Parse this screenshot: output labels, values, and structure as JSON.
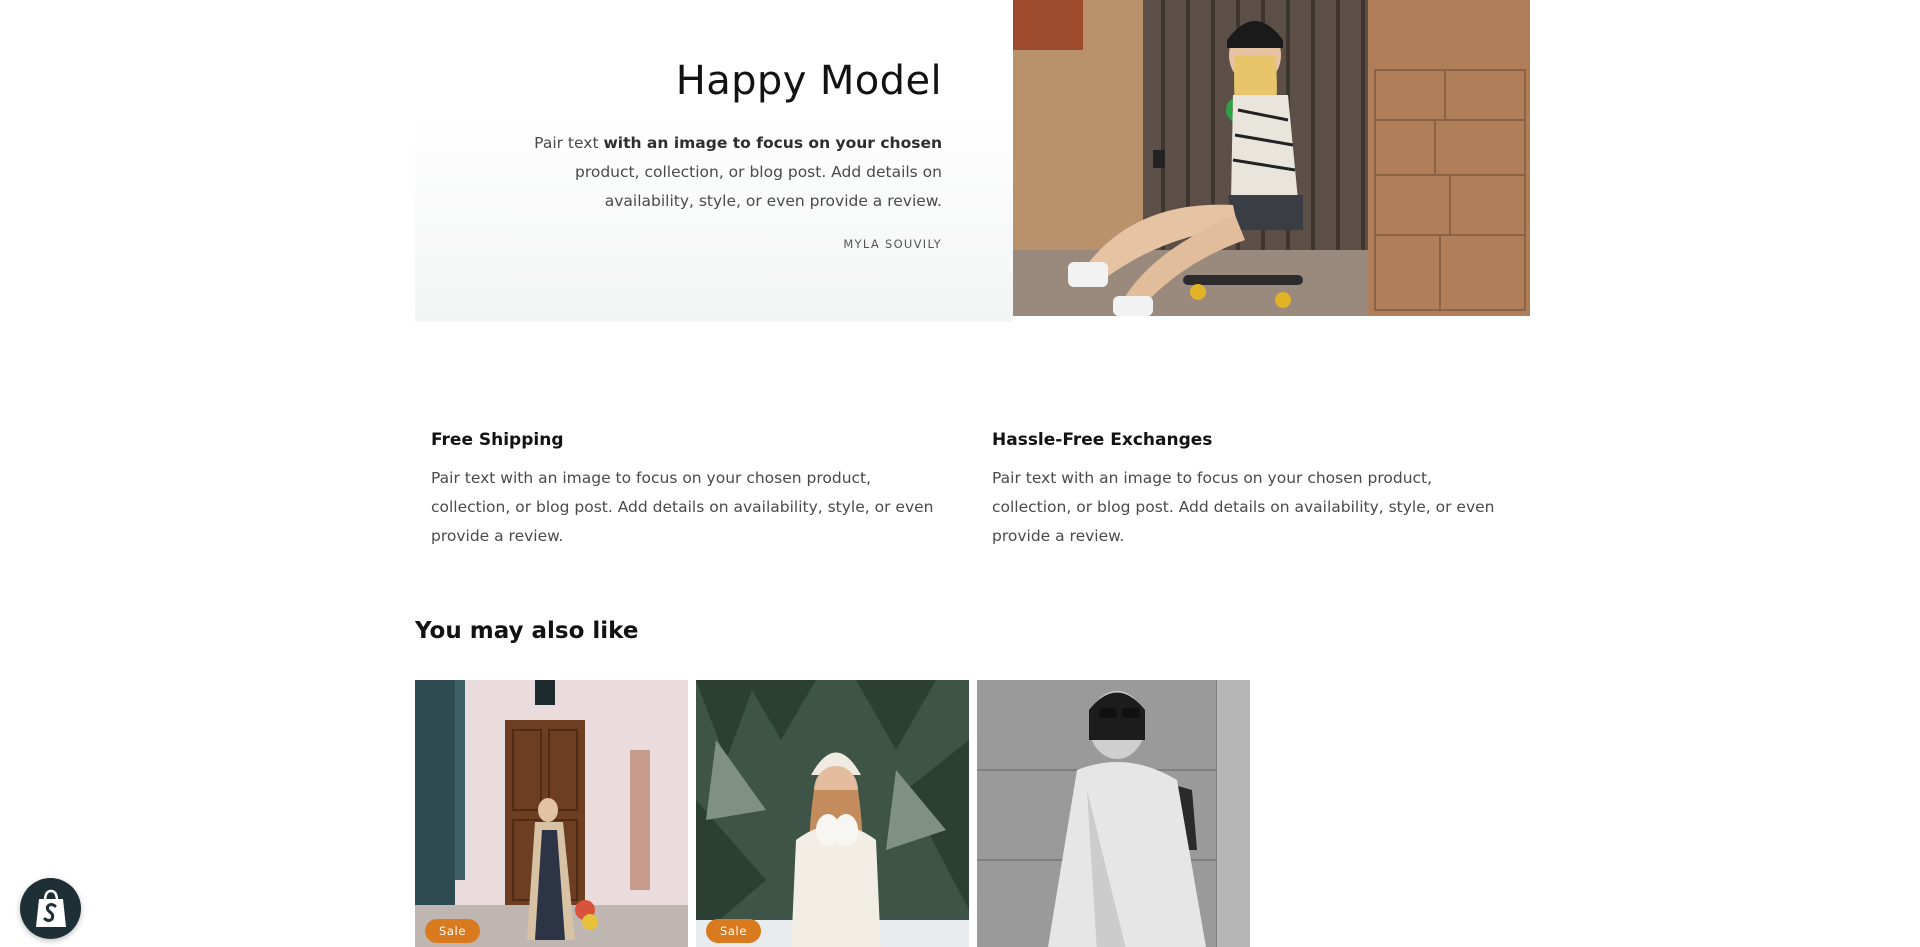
{
  "image_with_text": {
    "title": "Happy Model",
    "body_prefix": "Pair text ",
    "body_bold": "with an image to focus on your chosen",
    "body_suffix": " product, collection, or blog post. Add details on availability, style, or even provide a review.",
    "author": "MYLA SOUVILY"
  },
  "multicolumn": {
    "columns": [
      {
        "title": "Free Shipping",
        "text": "Pair text with an image to focus on your chosen product, collection, or blog post. Add details on availability, style, or even provide a review."
      },
      {
        "title": "Hassle-Free Exchanges",
        "text": "Pair text with an image to focus on your chosen product, collection, or blog post. Add details on availability, style, or even provide a review."
      }
    ]
  },
  "related": {
    "title": "You may also like",
    "products": [
      {
        "badge": "Sale",
        "image": "woman-in-corridor-with-flowers"
      },
      {
        "badge": "Sale",
        "image": "woman-in-white-beanie-snow"
      },
      {
        "badge": "",
        "image": "woman-in-sunglasses-grayscale"
      }
    ]
  },
  "colors": {
    "sale_badge": "#d97a1f",
    "shop_button": "#1f2f36"
  },
  "icons": {
    "shop_button": "shopify-bag-icon"
  }
}
